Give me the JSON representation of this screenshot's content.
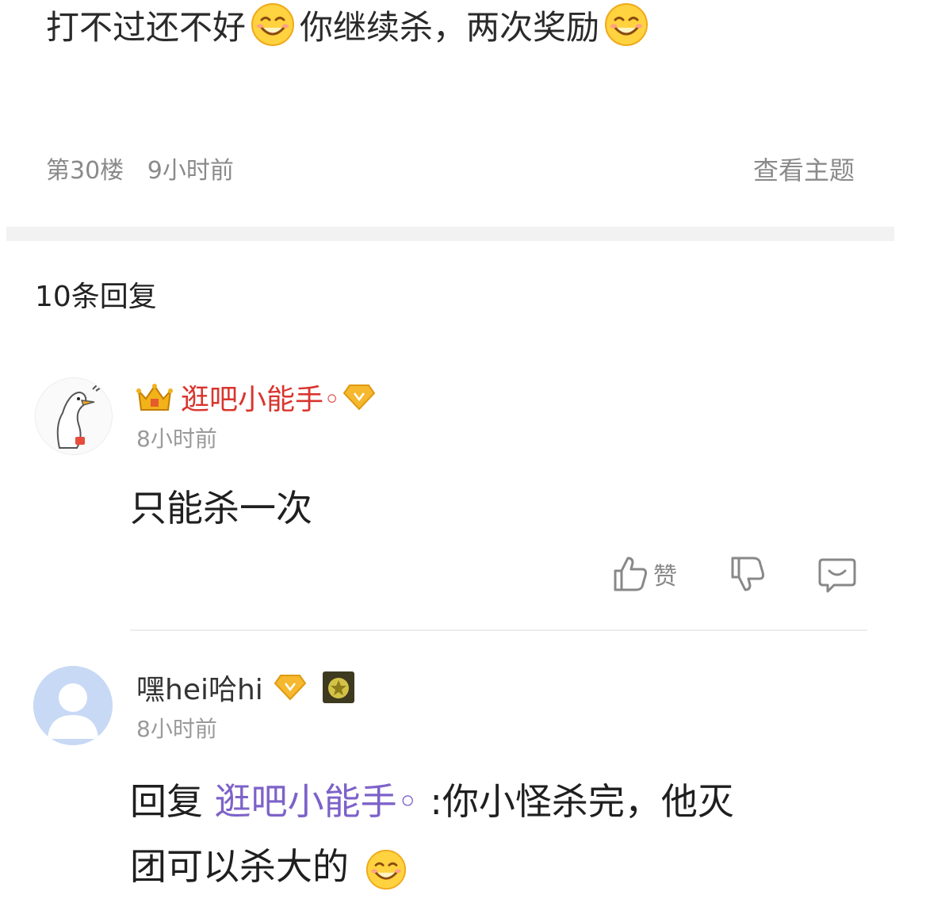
{
  "post": {
    "text_part1": "打不过还不好",
    "text_part2": "你继续杀，两次奖励",
    "floor": "第30楼",
    "time": "9小时前",
    "view_topic": "查看主题"
  },
  "replies": {
    "count_label": "10条回复",
    "items": [
      {
        "username": "逛吧小能手◦",
        "time": "8小时前",
        "text": "只能杀一次",
        "like_label": "赞"
      },
      {
        "username": "嘿hei哈hi",
        "time": "8小时前",
        "reply_prefix": "回复",
        "mention": "逛吧小能手◦",
        "text_part1": ":你小怪杀完，他灭",
        "text_part2": "团可以杀大的"
      }
    ]
  },
  "icons": [
    "smile-emoji-icon",
    "crown-icon",
    "diamond-icon",
    "member-badge-icon",
    "thumbs-up-icon",
    "thumbs-down-icon",
    "comment-icon"
  ],
  "colors": {
    "username_red": "#d9352e",
    "mention_purple": "#7d62c9",
    "meta_gray": "#8a8a8a",
    "gold": "#f2b21a"
  }
}
